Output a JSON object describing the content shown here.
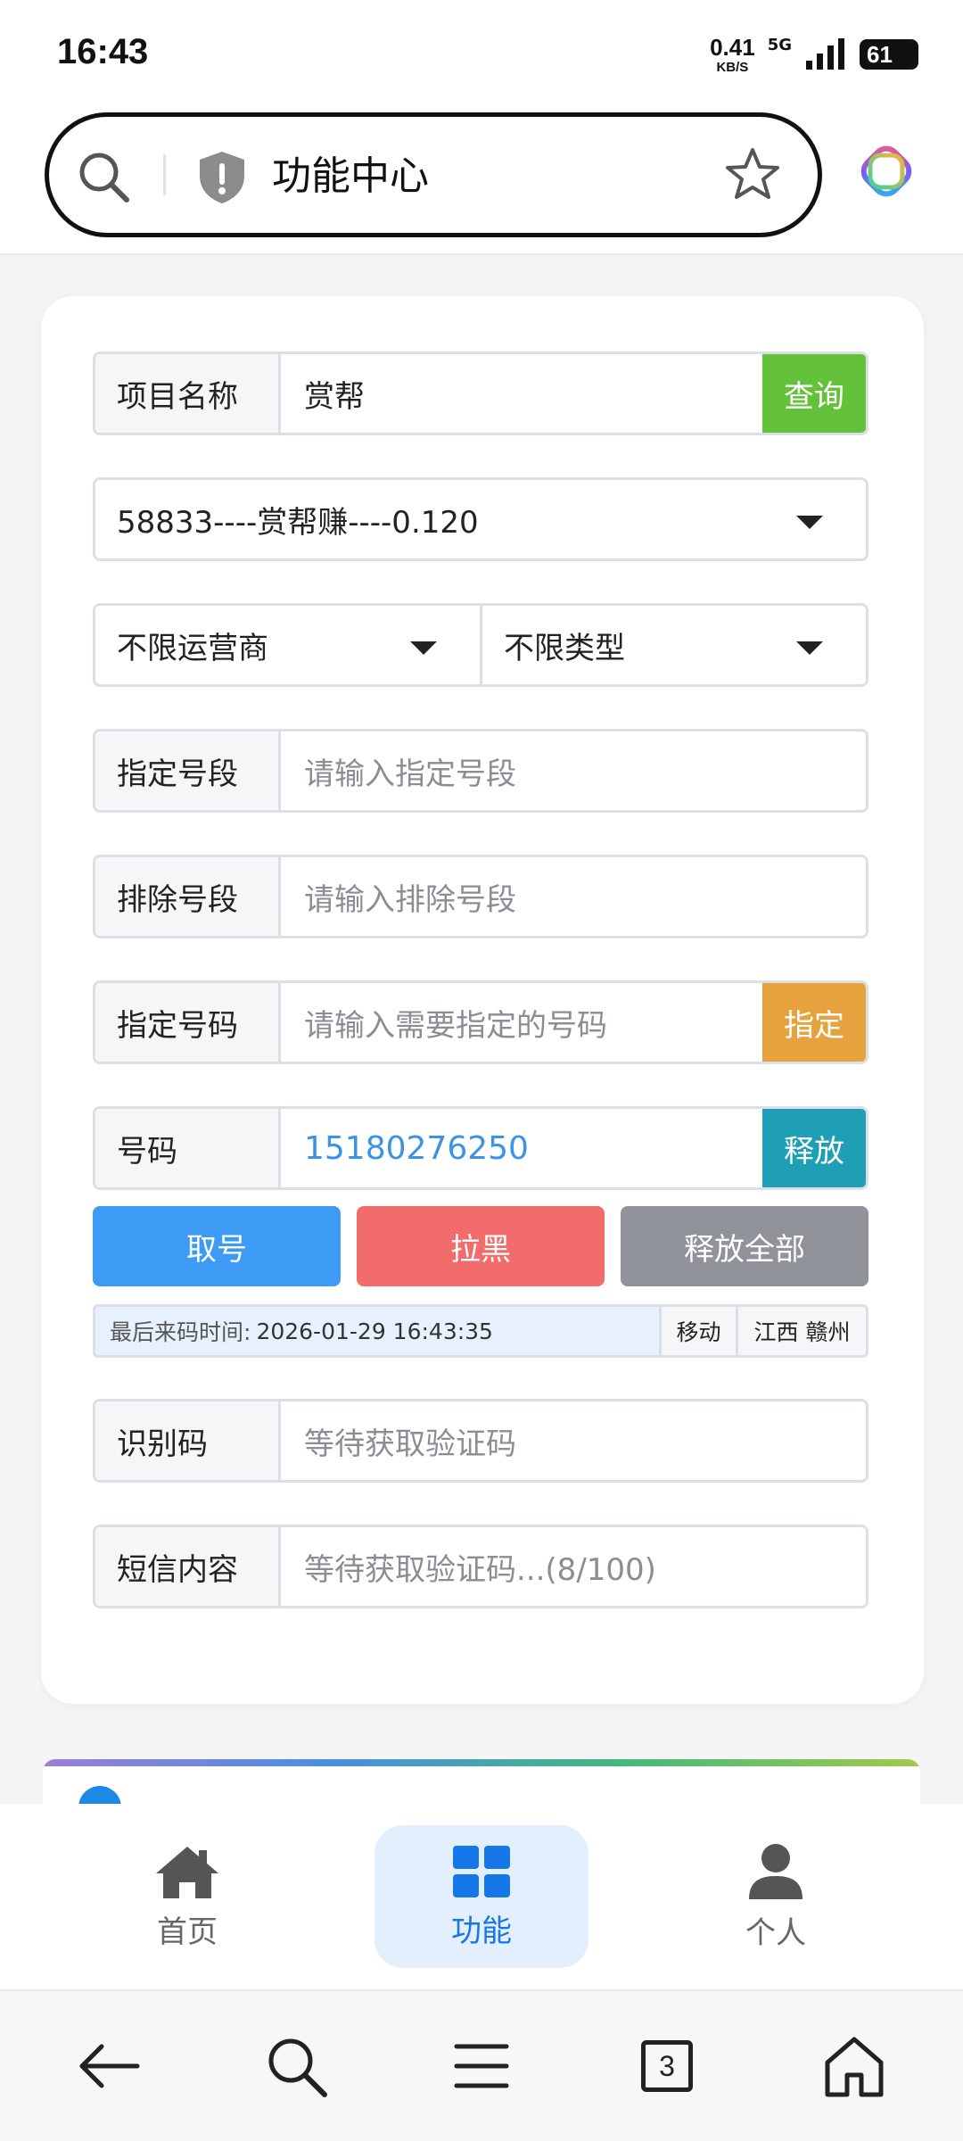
{
  "status": {
    "time": "16:43",
    "net_speed_value": "0.41",
    "net_speed_unit": "KB/S",
    "net_type": "5G",
    "battery": "61"
  },
  "address_bar": {
    "title": "功能中心"
  },
  "form": {
    "project": {
      "label": "项目名称",
      "value": "赏帮",
      "button": "查询"
    },
    "project_select": "58833----赏帮赚----0.120",
    "carrier_select": "不限运营商",
    "type_select": "不限类型",
    "prefix": {
      "label": "指定号段",
      "placeholder": "请输入指定号段"
    },
    "exclude": {
      "label": "排除号段",
      "placeholder": "请输入排除号段"
    },
    "specify": {
      "label": "指定号码",
      "placeholder": "请输入需要指定的号码",
      "button": "指定"
    },
    "number": {
      "label": "号码",
      "value": "15180276250",
      "button": "释放"
    },
    "actions": {
      "get": "取号",
      "blacklist": "拉黑",
      "release_all": "释放全部"
    },
    "info": {
      "last_code_label": "最后来码时间:",
      "last_code_time": "2026-01-29 16:43:35",
      "carrier": "移动",
      "region": "江西 赣州"
    },
    "code": {
      "label": "识别码",
      "placeholder": "等待获取验证码"
    },
    "sms": {
      "label": "短信内容",
      "placeholder": "等待获取验证码...(8/100)"
    }
  },
  "bottom_nav": {
    "home": "首页",
    "function": "功能",
    "personal": "个人"
  },
  "system_nav": {
    "tabs_count": "3"
  },
  "colors": {
    "query_green": "#64c23a",
    "specify_orange": "#e6a23c",
    "release_teal": "#1e9fb5",
    "get_blue": "#3d9af5",
    "blacklist_red": "#f26c6c",
    "release_all_gray": "#909399",
    "active_nav_blue": "#1677e8"
  }
}
